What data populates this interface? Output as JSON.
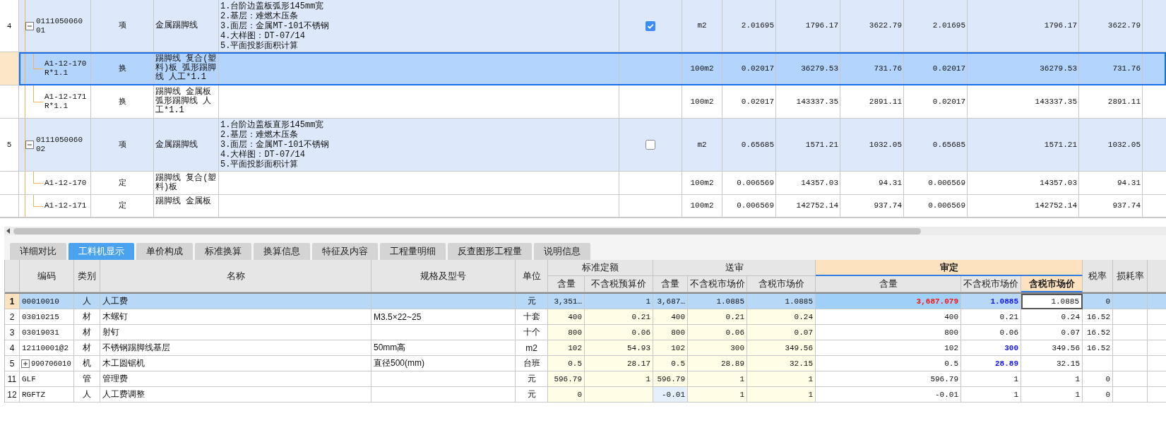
{
  "items_table": {
    "rows": [
      {
        "kind": "item",
        "num": "4",
        "code": "011105006001",
        "expanded": true,
        "type": "项",
        "name": "金属踢脚线",
        "features": "1.台阶边盖板弧形145mm宽\n2.基层：难燃木压条\n3.面层：金属MT-101不锈钢\n4.大样图：DT-07/14\n5.平面投影面积计算",
        "checked": true,
        "selected": false,
        "unit": "m2",
        "qty": "2.01695",
        "price": "1796.17",
        "total": "3622.79",
        "qty2": "2.01695",
        "price2": "1796.17",
        "total2": "3622.79"
      },
      {
        "kind": "sub",
        "num": "",
        "code": "A1-12-170 R*1.1",
        "type": "换",
        "name": "踢脚线 复合(塑料)板 弧形踢脚线 人工*1.1",
        "features": "",
        "selected": true,
        "unit": "100m2",
        "qty": "0.02017",
        "price": "36279.53",
        "total": "731.76",
        "qty2": "0.02017",
        "price2": "36279.53",
        "total2": "731.76"
      },
      {
        "kind": "sub",
        "num": "",
        "code": "A1-12-171 R*1.1",
        "type": "换",
        "name": "踢脚线 金属板弧形踢脚线 人工*1.1",
        "features": "",
        "selected": false,
        "unit": "100m2",
        "qty": "0.02017",
        "price": "143337.35",
        "total": "2891.11",
        "qty2": "0.02017",
        "price2": "143337.35",
        "total2": "2891.11"
      },
      {
        "kind": "item",
        "num": "5",
        "code": "011105006002",
        "expanded": true,
        "type": "项",
        "name": "金属踢脚线",
        "features": "1.台阶边盖板直形145mm宽\n2.基层：难燃木压条\n3.面层：金属MT-101不锈钢\n4.大样图：DT-07/14\n5.平面投影面积计算",
        "checked": false,
        "selected": false,
        "unit": "m2",
        "qty": "0.65685",
        "price": "1571.21",
        "total": "1032.05",
        "qty2": "0.65685",
        "price2": "1571.21",
        "total2": "1032.05"
      },
      {
        "kind": "sub",
        "num": "",
        "code": "A1-12-170",
        "type": "定",
        "name": "踢脚线 复合(塑料)板",
        "features": "",
        "selected": false,
        "unit": "100m2",
        "qty": "0.006569",
        "price": "14357.03",
        "total": "94.31",
        "qty2": "0.006569",
        "price2": "14357.03",
        "total2": "94.31"
      },
      {
        "kind": "sub",
        "num": "",
        "code": "A1-12-171",
        "type": "定",
        "name": "踢脚线 金属板",
        "features": "",
        "selected": false,
        "unit": "100m2",
        "qty": "0.006569",
        "price": "142752.14",
        "total": "937.74",
        "qty2": "0.006569",
        "price2": "142752.14",
        "total2": "937.74"
      }
    ]
  },
  "tabs": [
    {
      "label": "详细对比",
      "selected": false
    },
    {
      "label": "工料机显示",
      "selected": true
    },
    {
      "label": "单价构成",
      "selected": false
    },
    {
      "label": "标准换算",
      "selected": false
    },
    {
      "label": "换算信息",
      "selected": false
    },
    {
      "label": "特征及内容",
      "selected": false
    },
    {
      "label": "工程量明细",
      "selected": false
    },
    {
      "label": "反查图形工程量",
      "selected": false
    },
    {
      "label": "说明信息",
      "selected": false
    }
  ],
  "resources_table": {
    "columns": [
      {
        "label": "编码",
        "selected": false
      },
      {
        "label": "类别",
        "selected": false
      },
      {
        "label": "名称",
        "selected": false
      },
      {
        "label": "规格及型号",
        "selected": false
      },
      {
        "label": "单位",
        "selected": false
      },
      {
        "label": "含量",
        "group": "标准定额",
        "selected": false
      },
      {
        "label": "不含税预算价",
        "in_group": true,
        "selected": false
      },
      {
        "label": "含量",
        "group": "送审",
        "selected": false
      },
      {
        "label": "不含税市场价",
        "in_group": true,
        "selected": false
      },
      {
        "label": "含税市场价",
        "in_group": true,
        "selected": false
      },
      {
        "label": "含量",
        "group": "审定",
        "selected": false
      },
      {
        "label": "不含税市场价",
        "in_group": true,
        "selected": false
      },
      {
        "label": "含税市场价",
        "in_group": true,
        "selected": true
      },
      {
        "label": "税率",
        "selected": false
      },
      {
        "label": "损耗率",
        "selected": false
      }
    ],
    "rows": [
      {
        "num": "1",
        "selected": true,
        "revised_qty": true,
        "revised_price": true,
        "edited_sub_qty": false,
        "cells": [
          "00010010",
          "人",
          "人工费",
          "",
          "元",
          "3,351…",
          "1",
          "3,687…",
          "1.0885",
          "1.0885",
          "3,687.079",
          "1.0885",
          "1.0885",
          "0",
          ""
        ]
      },
      {
        "num": "2",
        "selected": false,
        "revised_qty": false,
        "revised_price": false,
        "edited_sub_qty": false,
        "cells": [
          "03010215",
          "材",
          "木螺钉",
          "M3.5×22~25",
          "十套",
          "400",
          "0.21",
          "400",
          "0.21",
          "0.24",
          "400",
          "0.21",
          "0.24",
          "16.52",
          ""
        ]
      },
      {
        "num": "3",
        "selected": false,
        "revised_qty": false,
        "revised_price": false,
        "edited_sub_qty": false,
        "cells": [
          "03019031",
          "材",
          "射钉",
          "",
          "十个",
          "800",
          "0.06",
          "800",
          "0.06",
          "0.07",
          "800",
          "0.06",
          "0.07",
          "16.52",
          ""
        ]
      },
      {
        "num": "4",
        "selected": false,
        "revised_qty": false,
        "revised_price": true,
        "edited_sub_qty": false,
        "cells": [
          "12110001@2",
          "材",
          "不锈钢踢脚线基层",
          "50mm高",
          "m2",
          "102",
          "54.93",
          "102",
          "300",
          "349.56",
          "102",
          "300",
          "349.56",
          "16.52",
          ""
        ]
      },
      {
        "num": "5",
        "selected": false,
        "expanded": false,
        "revised_qty": false,
        "revised_price": true,
        "edited_sub_qty": false,
        "cells": [
          "990706010",
          "机",
          "木工圆锯机",
          "直径500(mm)",
          "台班",
          "0.5",
          "28.17",
          "0.5",
          "28.89",
          "32.15",
          "0.5",
          "28.89",
          "32.15",
          "",
          ""
        ]
      },
      {
        "num": "11",
        "selected": false,
        "revised_qty": false,
        "revised_price": false,
        "edited_sub_qty": false,
        "cells": [
          "GLF",
          "管",
          "管理费",
          "",
          "元",
          "596.79",
          "1",
          "596.79",
          "1",
          "1",
          "596.79",
          "1",
          "1",
          "0",
          ""
        ]
      },
      {
        "num": "12",
        "selected": false,
        "revised_qty": false,
        "revised_price": false,
        "edited_sub_qty": true,
        "cells": [
          "RGFTZ",
          "人",
          "人工费调整",
          "",
          "元",
          "0",
          "",
          "-0.01",
          "1",
          "1",
          "-0.01",
          "1",
          "1",
          "0",
          ""
        ]
      }
    ]
  }
}
